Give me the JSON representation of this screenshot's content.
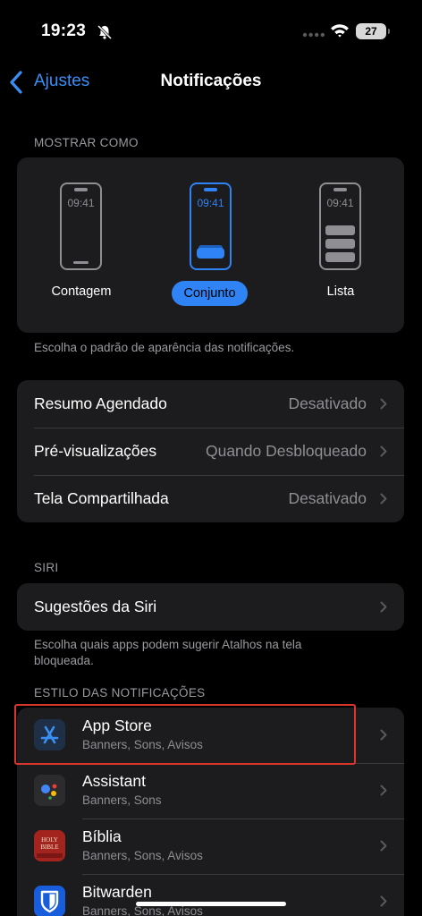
{
  "status": {
    "time": "19:23",
    "battery": "27"
  },
  "nav": {
    "back_label": "Ajustes",
    "title": "Notificações"
  },
  "display_as": {
    "header": "MOSTRAR COMO",
    "lock_time": "09:41",
    "options": [
      {
        "label": "Contagem",
        "selected": false
      },
      {
        "label": "Conjunto",
        "selected": true
      },
      {
        "label": "Lista",
        "selected": false
      }
    ],
    "footer": "Escolha o padrão de aparência das notificações."
  },
  "settings": [
    {
      "label": "Resumo Agendado",
      "value": "Desativado"
    },
    {
      "label": "Pré-visualizações",
      "value": "Quando Desbloqueado"
    },
    {
      "label": "Tela Compartilhada",
      "value": "Desativado"
    }
  ],
  "siri": {
    "header": "SIRI",
    "row_label": "Sugestões da Siri",
    "footer": "Escolha quais apps podem sugerir Atalhos na tela bloqueada."
  },
  "notification_style": {
    "header": "ESTILO DAS NOTIFICAÇÕES",
    "apps": [
      {
        "name": "App Store",
        "subtitle": "Banners, Sons, Avisos",
        "icon": "app-store-icon"
      },
      {
        "name": "Assistant",
        "subtitle": "Banners, Sons",
        "icon": "assistant-icon"
      },
      {
        "name": "Bíblia",
        "subtitle": "Banners, Sons, Avisos",
        "icon": "bible-icon",
        "icon_text": "HOLY BIBLE"
      },
      {
        "name": "Bitwarden",
        "subtitle": "Banners, Sons, Avisos",
        "icon": "bitwarden-icon"
      }
    ]
  },
  "colors": {
    "accent": "#2f83f4",
    "highlight": "#d8362a",
    "card": "#1c1c1e"
  }
}
